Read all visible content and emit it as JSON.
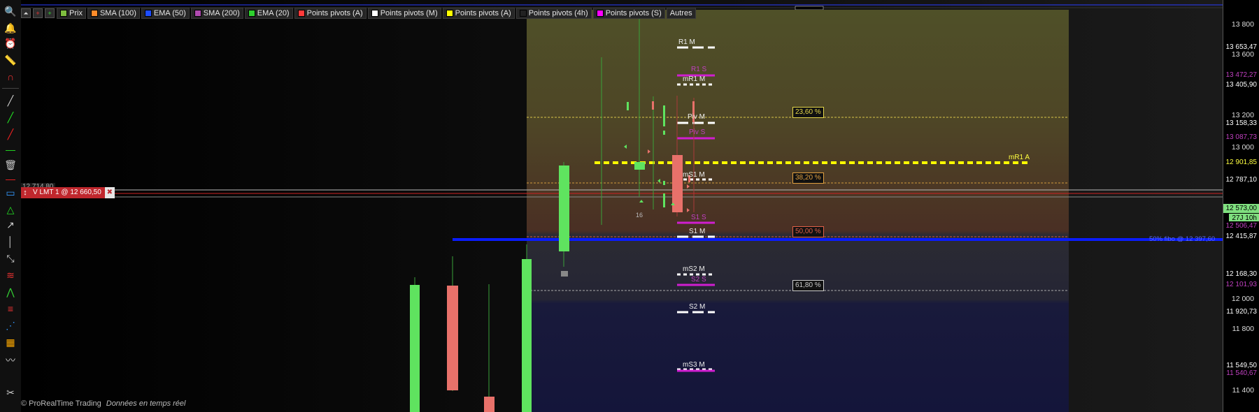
{
  "legend": [
    {
      "label": "Prix",
      "color": "#7fbf3f"
    },
    {
      "label": "SMA (100)",
      "color": "#ff8c2a"
    },
    {
      "label": "EMA (50)",
      "color": "#1d4dff"
    },
    {
      "label": "SMA (200)",
      "color": "#b04ab0"
    },
    {
      "label": "EMA (20)",
      "color": "#2fd12f"
    },
    {
      "label": "Points pivots (A)",
      "color": "#ff3a3a"
    },
    {
      "label": "Points pivots (M)",
      "color": "#ffffff"
    },
    {
      "label": "Points pivots (A)",
      "color": "#ffff00"
    },
    {
      "label": "Points pivots (4h)",
      "color": "#222222"
    },
    {
      "label": "Points pivots (S)",
      "color": "#ff00ff"
    }
  ],
  "legend_more": "Autres",
  "price_axis": {
    "ticks": [
      "13 800",
      "13 600",
      "13 200",
      "13 000",
      "12 000",
      "11 800",
      "11 400"
    ],
    "tags": [
      {
        "text": "13 653,47",
        "bg": "#000",
        "fg": "#fff"
      },
      {
        "text": "13 472,27",
        "bg": "#000",
        "fg": "#c040c0"
      },
      {
        "text": "13 405,90",
        "bg": "#000",
        "fg": "#fff"
      },
      {
        "text": "13 158,33",
        "bg": "#000",
        "fg": "#fff"
      },
      {
        "text": "13 087,73",
        "bg": "#000",
        "fg": "#c040c0"
      },
      {
        "text": "12 901,85",
        "bg": "#000",
        "fg": "#ffff40"
      },
      {
        "text": "12 787,10",
        "bg": "#000",
        "fg": "#fff"
      },
      {
        "text": "12 573,00",
        "bg": "#7fe07f",
        "fg": "#000"
      },
      {
        "text": "27J 10h",
        "bg": "#7fe07f",
        "fg": "#000"
      },
      {
        "text": "12 506,47",
        "bg": "#000",
        "fg": "#c040c0"
      },
      {
        "text": "12 415,87",
        "bg": "#000",
        "fg": "#fff"
      },
      {
        "text": "12 168,30",
        "bg": "#000",
        "fg": "#fff"
      },
      {
        "text": "12 101,93",
        "bg": "#000",
        "fg": "#c040c0"
      },
      {
        "text": "11 920,73",
        "bg": "#000",
        "fg": "#fff"
      },
      {
        "text": "11 549,50",
        "bg": "#000",
        "fg": "#fff"
      },
      {
        "text": "11 540,67",
        "bg": "#000",
        "fg": "#c040c0"
      }
    ]
  },
  "pivots": {
    "R1M": "R1 M",
    "R1S": "R1 S",
    "mR1M": "mR1 M",
    "PivM": "Piv M",
    "PivS": "Piv S",
    "mS1M": "mS1 M",
    "S1S": "S1 S",
    "S1M": "S1 M",
    "mS2M": "mS2 M",
    "S2S": "S2 S",
    "S2M": "S2 M",
    "mS3M": "mS3 M",
    "mR1A": "mR1 A"
  },
  "fibo": {
    "f236": "23,60 %",
    "f382": "38,20 %",
    "f500": "50,00 %",
    "f618": "61,80 %"
  },
  "ema_label": "50% fibo @ 12 397,60",
  "order": {
    "label": "V LMT  1 @ 12 660,50",
    "price_left": "12 714,80",
    "close": "✖"
  },
  "count_label": "16",
  "footer": {
    "brand": "© ProRealTime Trading",
    "status": "Données en temps réel"
  }
}
